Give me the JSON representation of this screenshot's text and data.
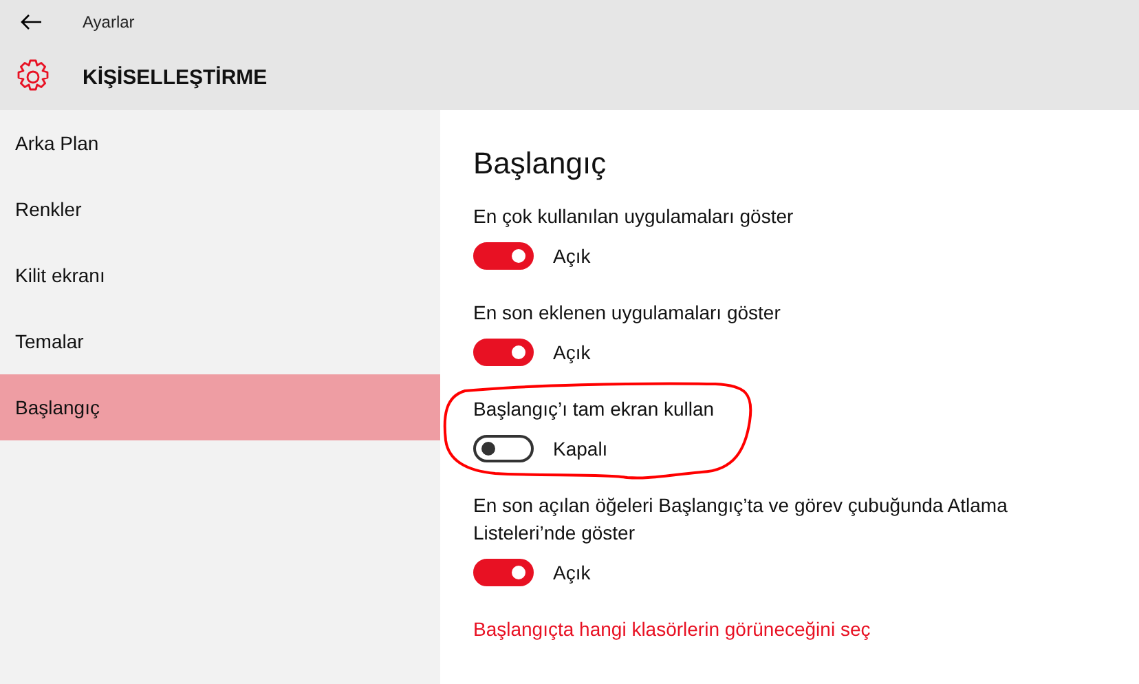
{
  "window": {
    "title": "Ayarlar"
  },
  "header": {
    "title": "KİŞİSELLEŞTİRME"
  },
  "sidebar": {
    "items": [
      {
        "label": "Arka Plan",
        "selected": false
      },
      {
        "label": "Renkler",
        "selected": false
      },
      {
        "label": "Kilit ekranı",
        "selected": false
      },
      {
        "label": "Temalar",
        "selected": false
      },
      {
        "label": "Başlangıç",
        "selected": true
      }
    ]
  },
  "content": {
    "heading": "Başlangıç",
    "settings": [
      {
        "label": "En çok kullanılan uygulamaları göster",
        "on": true,
        "state_text": "Açık",
        "highlighted": false
      },
      {
        "label": "En son eklenen uygulamaları göster",
        "on": true,
        "state_text": "Açık",
        "highlighted": false
      },
      {
        "label": "Başlangıç’ı tam ekran kullan",
        "on": false,
        "state_text": "Kapalı",
        "highlighted": true
      },
      {
        "label": "En son açılan öğeleri Başlangıç’ta ve görev çubuğunda Atlama Listeleri’nde göster",
        "on": true,
        "state_text": "Açık",
        "highlighted": false
      }
    ],
    "link": "Başlangıçta hangi klasörlerin görüneceğini seç"
  }
}
